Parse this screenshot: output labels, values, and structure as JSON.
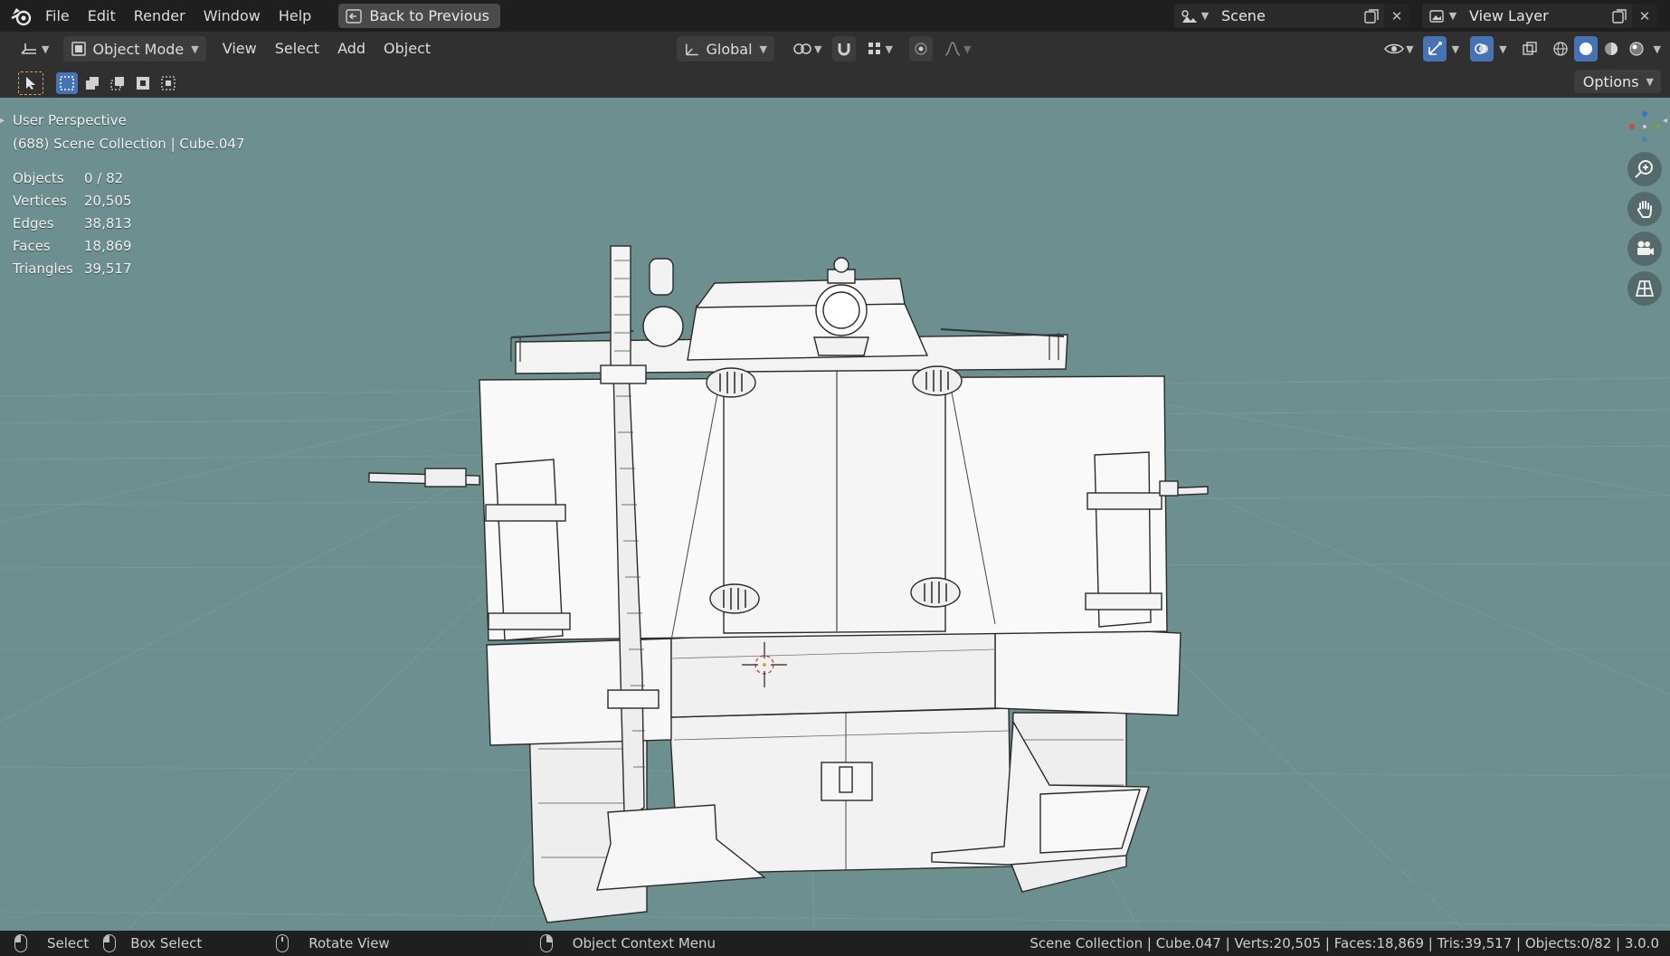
{
  "menu": {
    "items": [
      "File",
      "Edit",
      "Render",
      "Window",
      "Help"
    ],
    "back_button": "Back to Previous"
  },
  "scene": {
    "name": "Scene"
  },
  "view_layer": {
    "name": "View Layer"
  },
  "header": {
    "mode": "Object Mode",
    "menus": [
      "View",
      "Select",
      "Add",
      "Object"
    ],
    "transform_orientation": "Global"
  },
  "toolbar": {
    "options_label": "Options"
  },
  "viewport": {
    "perspective_label": "User Perspective",
    "collection_label": "(688) Scene Collection | Cube.047",
    "stats": [
      {
        "label": "Objects",
        "value": "0 / 82"
      },
      {
        "label": "Vertices",
        "value": "20,505"
      },
      {
        "label": "Edges",
        "value": "38,813"
      },
      {
        "label": "Faces",
        "value": "18,869"
      },
      {
        "label": "Triangles",
        "value": "39,517"
      }
    ]
  },
  "statusbar": {
    "select": "Select",
    "box_select": "Box Select",
    "rotate_view": "Rotate View",
    "context_menu": "Object Context Menu",
    "info": "Scene Collection | Cube.047 | Verts:20,505 | Faces:18,869 | Tris:39,517 | Objects:0/82 | 3.0.0"
  },
  "colors": {
    "viewport_bg": "#6e8f8f",
    "accent": "#4772b3",
    "header_bg": "#303030",
    "topbar_bg": "#1f1f1f"
  }
}
